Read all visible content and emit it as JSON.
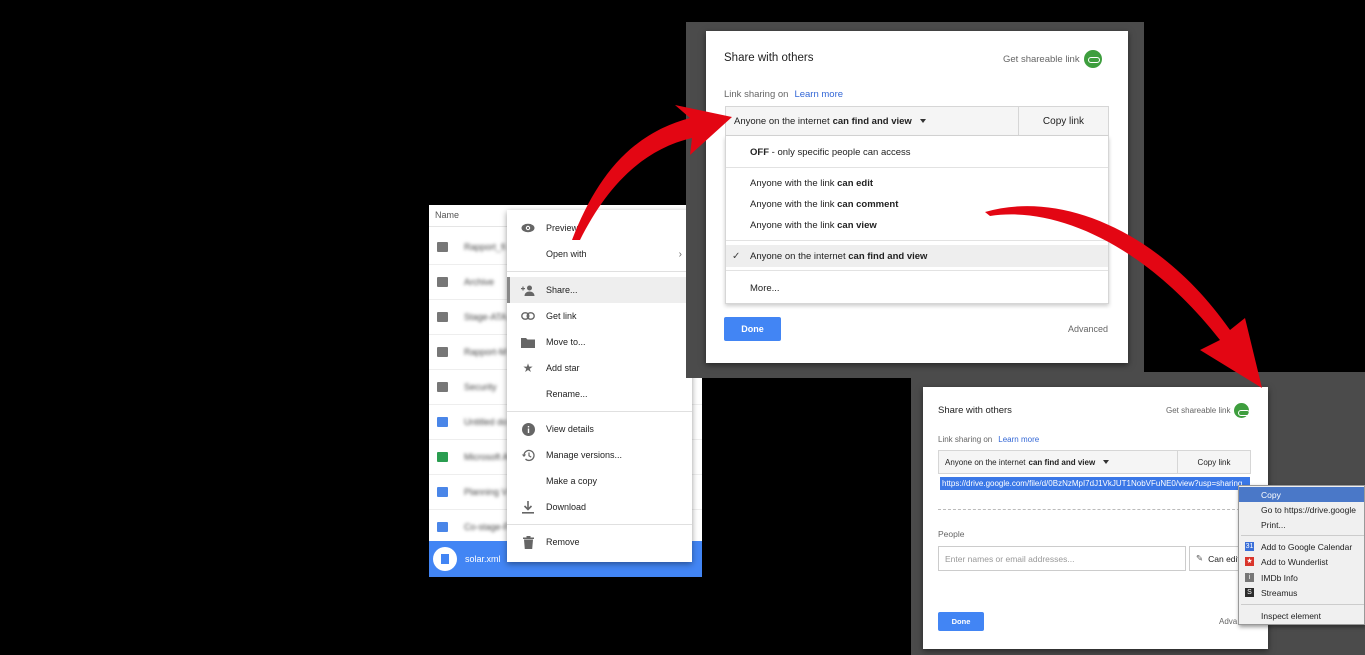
{
  "drive": {
    "column_header": "Name",
    "files": [
      {
        "name": "Rapport_fi",
        "type": "folder"
      },
      {
        "name": "Archive",
        "type": "folder"
      },
      {
        "name": "Stage-ATA",
        "type": "folder"
      },
      {
        "name": "Rapport-M",
        "type": "folder"
      },
      {
        "name": "Security",
        "type": "shared-folder"
      },
      {
        "name": "Untitled do",
        "type": "doc"
      },
      {
        "name": "Microsoft A",
        "type": "sheet"
      },
      {
        "name": "Planning V",
        "type": "doc"
      },
      {
        "name": "Co-stage-F",
        "type": "doc"
      }
    ],
    "selected_file": "solar.xml",
    "context_menu": [
      {
        "label": "Preview",
        "icon": "eye-icon"
      },
      {
        "label": "Open with",
        "icon": "",
        "submenu": true
      },
      {
        "label": "Share...",
        "icon": "add-person-icon"
      },
      {
        "label": "Get link",
        "icon": "link-icon"
      },
      {
        "label": "Move to...",
        "icon": "folder-icon"
      },
      {
        "label": "Add star",
        "icon": "star-icon"
      },
      {
        "label": "Rename...",
        "icon": ""
      },
      {
        "label": "View details",
        "icon": "info-icon"
      },
      {
        "label": "Manage versions...",
        "icon": "history-icon"
      },
      {
        "label": "Make a copy",
        "icon": ""
      },
      {
        "label": "Download",
        "icon": "download-icon"
      },
      {
        "label": "Remove",
        "icon": "trash-icon"
      }
    ]
  },
  "share_dialog_1": {
    "title": "Share with others",
    "get_shareable_link": "Get shareable link",
    "link_sharing": "Link sharing on",
    "learn_more": "Learn more",
    "selected_prefix": "Anyone on the internet",
    "selected_bold": "can find and view",
    "copy_link": "Copy link",
    "options": [
      {
        "bold_first": true,
        "bold": "OFF",
        "text": " - only specific people can access"
      },
      {
        "text": "Anyone with the link ",
        "bold": "can edit"
      },
      {
        "text": "Anyone with the link ",
        "bold": "can comment"
      },
      {
        "text": "Anyone with the link ",
        "bold": "can view"
      },
      {
        "text": "Anyone on the internet ",
        "bold": "can find and view",
        "checked": true
      },
      {
        "text": "More..."
      }
    ],
    "done": "Done",
    "advanced": "Advanced"
  },
  "share_dialog_2": {
    "title": "Share with others",
    "get_shareable_link": "Get shareable link",
    "link_sharing": "Link sharing on",
    "learn_more": "Learn more",
    "selected_prefix": "Anyone on the internet",
    "selected_bold": "can find and view",
    "copy_link": "Copy link",
    "url": "https://drive.google.com/file/d/0BzNzMpI7dJ1VkJUT1NobVFuNE0/view?usp=sharing",
    "people_label": "People",
    "people_placeholder": "Enter names or email addresses...",
    "can_edit": "Can edit",
    "done": "Done",
    "advanced": "Adva"
  },
  "browser_menu": {
    "items": [
      {
        "label": "Copy",
        "highlight": true
      },
      {
        "label": "Go to https://drive.google"
      },
      {
        "label": "Print..."
      },
      {
        "label": "Add to Google Calendar",
        "icon": "calendar-icon",
        "color": "#3b6fd8"
      },
      {
        "label": "Add to Wunderlist",
        "icon": "wunderlist-icon",
        "color": "#d9352b"
      },
      {
        "label": "IMDb Info",
        "icon": "imdb-icon",
        "color": "#777777"
      },
      {
        "label": "Streamus",
        "icon": "streamus-icon",
        "color": "#2b2b2b"
      },
      {
        "label": "Inspect element"
      }
    ]
  },
  "colors": {
    "accent": "#4285f4",
    "arrow": "#e30613",
    "link_badge": "#3e9e3e"
  }
}
